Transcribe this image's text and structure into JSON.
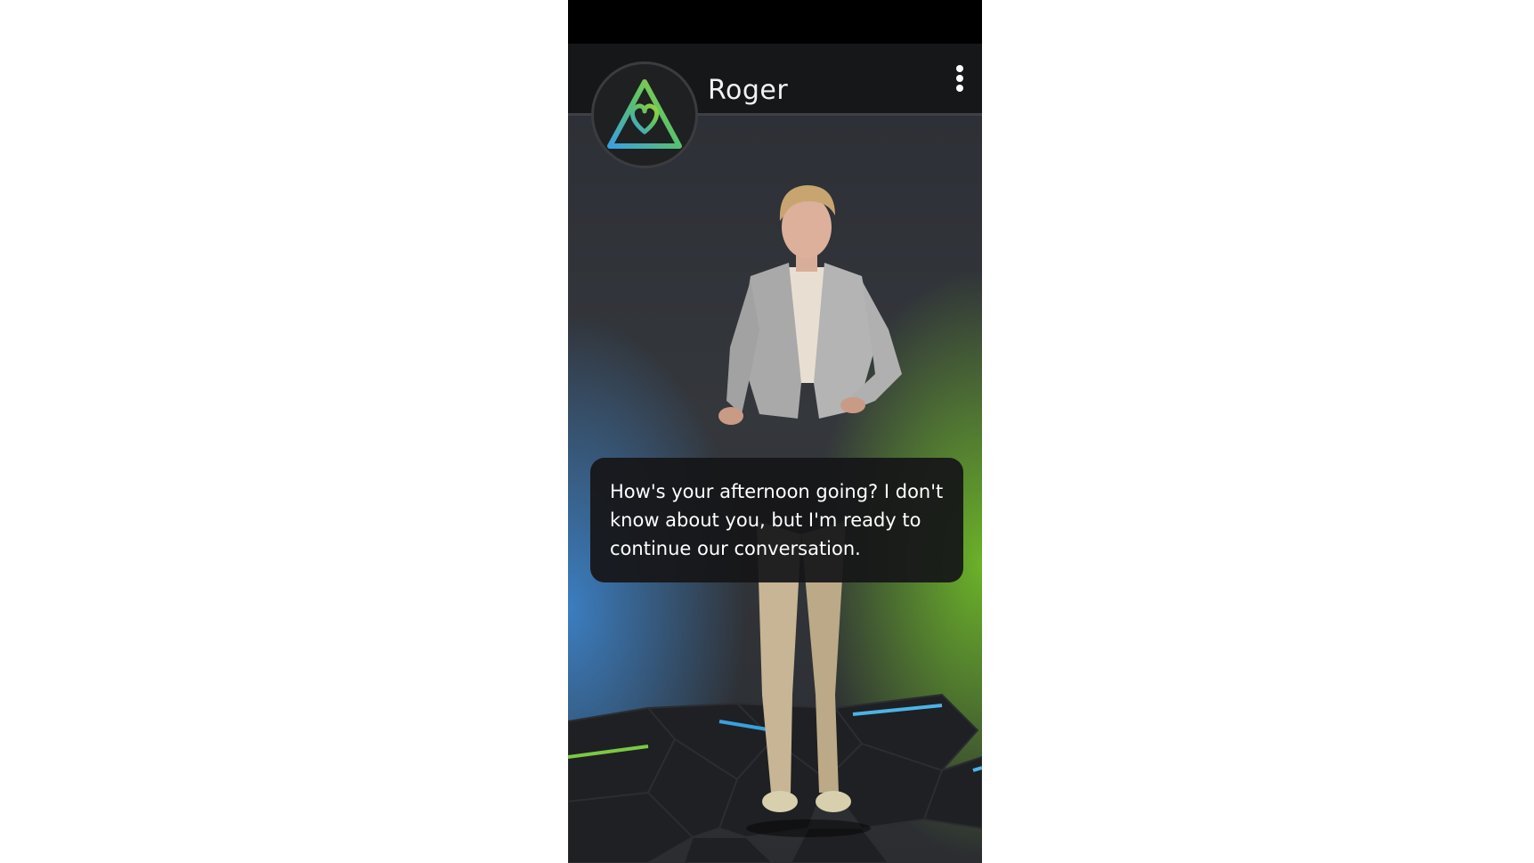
{
  "header": {
    "title": "Roger"
  },
  "chat": {
    "message": "How's your afternoon going? I don't know about you, but I'm ready to continue our conversation."
  },
  "icons": {
    "logo": "triangle-heart-logo-icon",
    "menu": "more-vertical-icon"
  },
  "colors": {
    "accent_green": "#7ac943",
    "accent_blue": "#3aa0e0",
    "header_bg": "#161718",
    "bubble_bg": "#161618"
  }
}
